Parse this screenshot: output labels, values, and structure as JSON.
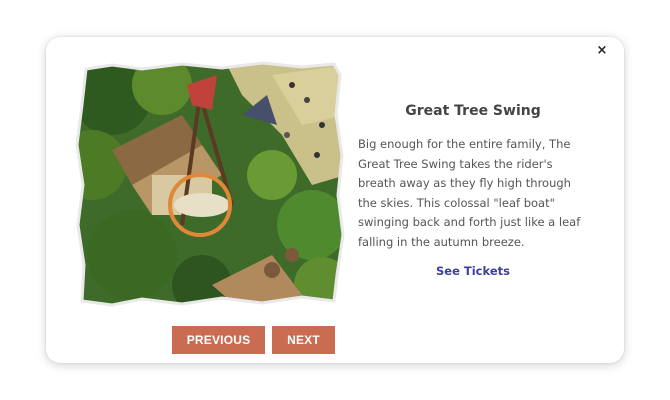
{
  "modal": {
    "close_label": "×",
    "title": "Great Tree Swing",
    "description": "Big enough for the entire family, The Great Tree Swing takes the rider's breath away as they fly high through the skies. This colossal \"leaf boat\" swinging back and forth just like a leaf falling in the autumn breeze.",
    "link_label": "See Tickets",
    "prev_label": "PREVIOUS",
    "next_label": "NEXT"
  },
  "colors": {
    "button_bg": "#c96c52",
    "link": "#3d3f9e",
    "highlight_circle": "#e0873a"
  },
  "image": {
    "subject": "aerial concept art of theme park ride with highlighted swing"
  }
}
